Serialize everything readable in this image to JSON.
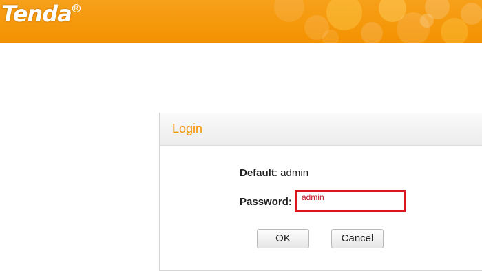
{
  "header": {
    "logo_text": "Tenda",
    "logo_mark": "R",
    "brand_color": "#f39200"
  },
  "login": {
    "title": "Login",
    "default_label": "Default",
    "default_value": ": admin",
    "password_label": "Password:",
    "password_value": "admin",
    "ok_label": "OK",
    "cancel_label": "Cancel",
    "highlight_color": "#e0141e"
  }
}
